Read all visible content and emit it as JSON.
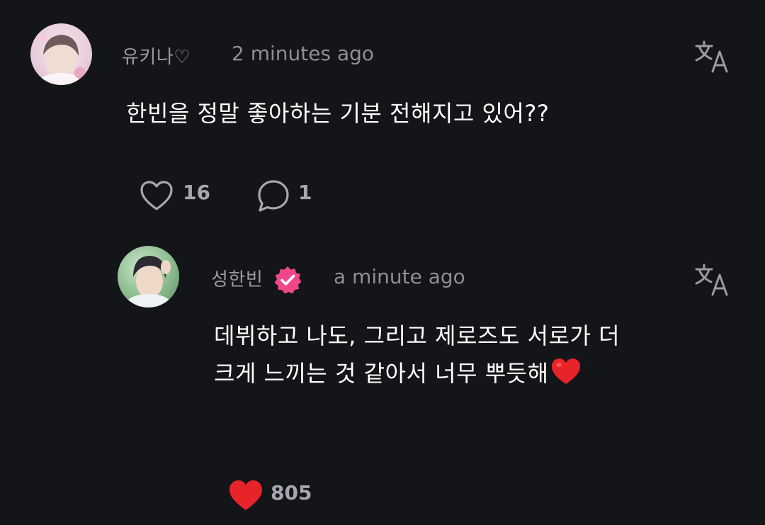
{
  "comments": [
    {
      "username": "유키나♡",
      "timestamp": "2 minutes ago",
      "text": "한빈을 정말 좋아하는 기분 전해지고 있어??",
      "likes": "16",
      "replies": "1",
      "liked": false,
      "translate_icon": "translate-icon"
    },
    {
      "username": "성한빈",
      "verified": true,
      "timestamp": "a minute ago",
      "text": "데뷔하고 나도, 그리고 제로즈도 서로가 더 크게 느끼는 것 같아서 너무 뿌듯해",
      "text_emoji": "red-heart-emoji",
      "likes": "805",
      "liked": true,
      "translate_icon": "translate-icon"
    }
  ],
  "colors": {
    "background": "#141518",
    "meta_text": "#9a9aa4",
    "verified_badge": "#f0478a",
    "liked_heart": "#e8232a"
  }
}
